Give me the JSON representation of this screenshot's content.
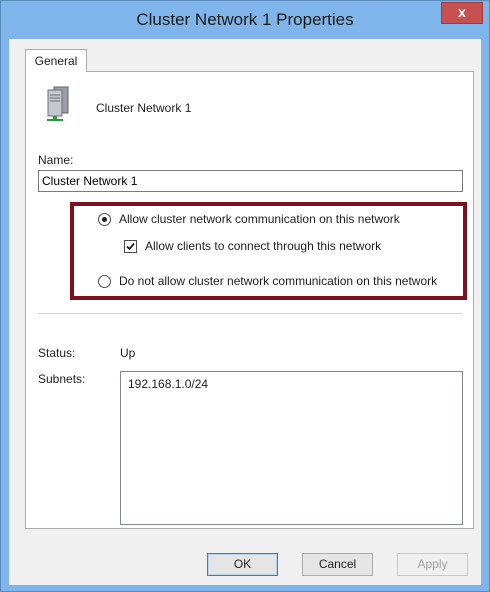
{
  "window": {
    "title": "Cluster Network 1 Properties",
    "close_glyph": "x"
  },
  "tabs": [
    {
      "label": "General",
      "selected": true
    }
  ],
  "general": {
    "network_icon": "server-network-icon",
    "network_name": "Cluster Network 1",
    "name_label": "Name:",
    "name_value": "Cluster Network 1",
    "options": {
      "allow_cluster_comm": {
        "label": "Allow cluster network communication on this network",
        "checked": true
      },
      "allow_clients": {
        "label": "Allow clients to connect through this network",
        "checked": true
      },
      "disallow_cluster_comm": {
        "label": "Do not allow cluster network communication on this network",
        "checked": false
      }
    },
    "status_label": "Status:",
    "status_value": "Up",
    "subnets_label": "Subnets:",
    "subnets": [
      "192.168.1.0/24"
    ]
  },
  "buttons": {
    "ok": "OK",
    "cancel": "Cancel",
    "apply": "Apply"
  },
  "colors": {
    "titlebar": "#7fb5ea",
    "close_button": "#c75050",
    "highlight_border": "#7a1020"
  }
}
